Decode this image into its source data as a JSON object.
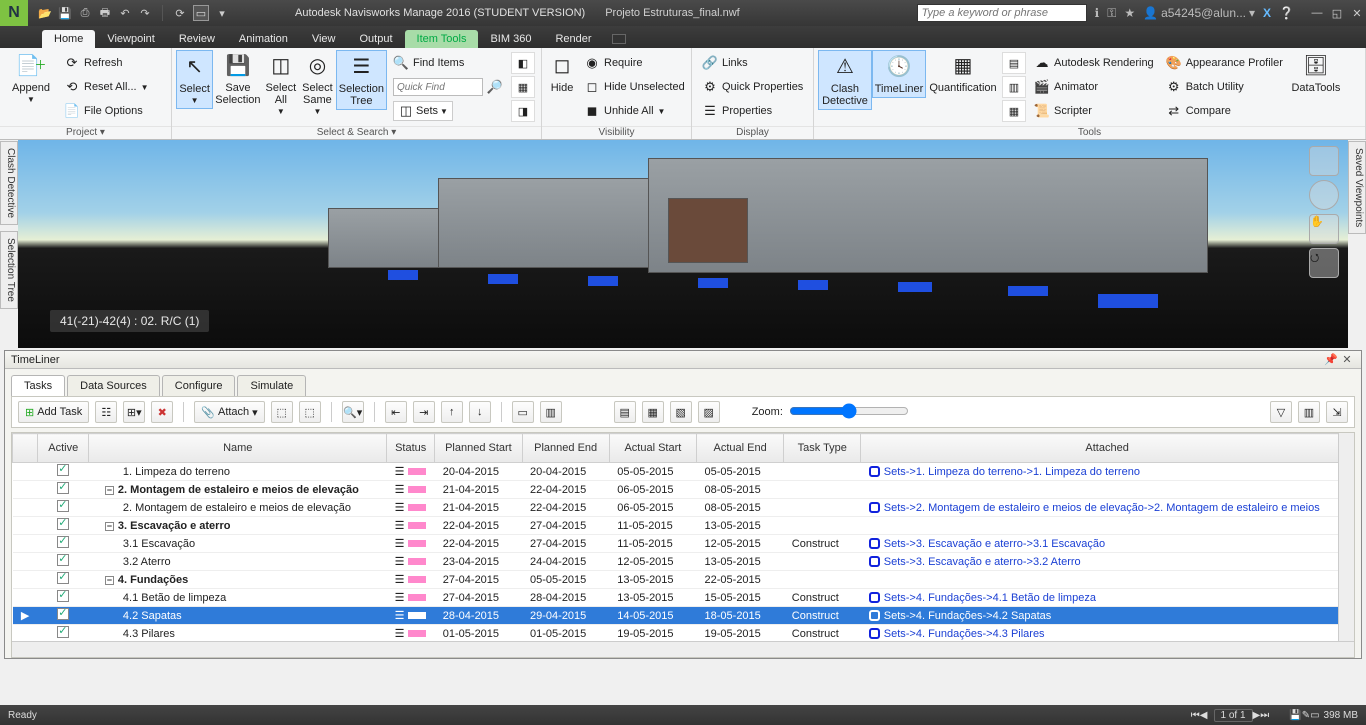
{
  "title": "Autodesk Navisworks Manage 2016 (STUDENT VERSION)",
  "filename": "Projeto Estruturas_final.nwf",
  "search_placeholder": "Type a keyword or phrase",
  "user": "a54245@alun...",
  "menu": [
    "Home",
    "Viewpoint",
    "Review",
    "Animation",
    "View",
    "Output",
    "Item Tools",
    "BIM 360",
    "Render"
  ],
  "menu_active": 0,
  "menu_ctx": 6,
  "ribbon": {
    "project": {
      "label": "Project ▾",
      "append": "Append",
      "items": [
        "Refresh",
        "Reset All...",
        "File Options"
      ]
    },
    "select": {
      "label": "Select & Search ▾",
      "select": "Select",
      "save_sel": "Save\nSelection",
      "sel_all": "Select\nAll",
      "sel_same": "Select\nSame",
      "sel_tree": "Selection\nTree",
      "find": "Find Items",
      "quick": "Quick Find",
      "sets": "Sets"
    },
    "visibility": {
      "label": "Visibility",
      "hide": "Hide",
      "rows": [
        "Require",
        "Hide Unselected",
        "Unhide All"
      ]
    },
    "display": {
      "label": "Display",
      "rows": [
        "Links",
        "Quick Properties",
        "Properties"
      ]
    },
    "clash": "Clash\nDetective",
    "timeliner": "TimeLiner",
    "quant": "Quantification",
    "tools": {
      "label": "Tools",
      "col1": [
        "Autodesk Rendering",
        "Animator",
        "Scripter"
      ],
      "col2": [
        "Appearance Profiler",
        "Batch Utility",
        "Compare"
      ]
    },
    "datatools": "DataTools"
  },
  "viewport_overlay": "41(-21)-42(4) : 02. R/C (1)",
  "side_left": [
    "Clash Detective",
    "Selection Tree"
  ],
  "side_right": [
    "Saved Viewpoints"
  ],
  "panel_title": "TimeLiner",
  "tl_tabs": [
    "Tasks",
    "Data Sources",
    "Configure",
    "Simulate"
  ],
  "tl_tab_active": 0,
  "add_task": "Add Task",
  "attach": "Attach",
  "zoom": "Zoom:",
  "columns": [
    "",
    "Active",
    "Name",
    "Status",
    "Planned Start",
    "Planned End",
    "Actual Start",
    "Actual End",
    "Task Type",
    "Attached"
  ],
  "rows": [
    {
      "mark": "",
      "lvl": 1,
      "exp": "",
      "name": "1. Limpeza do terreno",
      "ps": "20-04-2015",
      "pe": "20-04-2015",
      "as": "05-05-2015",
      "ae": "05-05-2015",
      "tt": "",
      "att": "Sets->1. Limpeza do terreno->1. Limpeza do terreno",
      "ico": 0
    },
    {
      "mark": "",
      "lvl": 0,
      "exp": "-",
      "name": "2. Montagem de estaleiro e meios de elevação",
      "bold": 1,
      "ps": "21-04-2015",
      "pe": "22-04-2015",
      "as": "06-05-2015",
      "ae": "08-05-2015",
      "tt": "",
      "att": ""
    },
    {
      "mark": "",
      "lvl": 1,
      "exp": "",
      "name": "2. Montagem de estaleiro e meios de elevação",
      "ps": "21-04-2015",
      "pe": "22-04-2015",
      "as": "06-05-2015",
      "ae": "08-05-2015",
      "tt": "",
      "att": "Sets->2. Montagem de estaleiro e meios de elevação->2. Montagem de estaleiro e meios",
      "ico": 1
    },
    {
      "mark": "",
      "lvl": 0,
      "exp": "-",
      "name": "3. Escavação e aterro",
      "bold": 1,
      "ps": "22-04-2015",
      "pe": "27-04-2015",
      "as": "11-05-2015",
      "ae": "13-05-2015",
      "tt": "",
      "att": ""
    },
    {
      "mark": "",
      "lvl": 1,
      "exp": "",
      "name": "3.1 Escavação",
      "ps": "22-04-2015",
      "pe": "27-04-2015",
      "as": "11-05-2015",
      "ae": "12-05-2015",
      "tt": "Construct",
      "att": "Sets->3. Escavação e aterro->3.1 Escavação",
      "ico": 1
    },
    {
      "mark": "",
      "lvl": 1,
      "exp": "",
      "name": "3.2 Aterro",
      "ps": "23-04-2015",
      "pe": "24-04-2015",
      "as": "12-05-2015",
      "ae": "13-05-2015",
      "tt": "",
      "att": "Sets->3. Escavação e aterro->3.2 Aterro",
      "ico": 1
    },
    {
      "mark": "",
      "lvl": 0,
      "exp": "-",
      "name": "4. Fundações",
      "bold": 1,
      "ps": "27-04-2015",
      "pe": "05-05-2015",
      "as": "13-05-2015",
      "ae": "22-05-2015",
      "tt": "",
      "att": ""
    },
    {
      "mark": "",
      "lvl": 1,
      "exp": "",
      "name": "4.1 Betão de limpeza",
      "ps": "27-04-2015",
      "pe": "28-04-2015",
      "as": "13-05-2015",
      "ae": "15-05-2015",
      "tt": "Construct",
      "att": "Sets->4. Fundações->4.1 Betão de limpeza",
      "ico": 1
    },
    {
      "mark": "▶",
      "lvl": 1,
      "exp": "",
      "name": "4.2 Sapatas",
      "ps": "28-04-2015",
      "pe": "29-04-2015",
      "as": "14-05-2015",
      "ae": "18-05-2015",
      "tt": "Construct",
      "att": "Sets->4. Fundações->4.2 Sapatas",
      "ico": 1,
      "sel": 1
    },
    {
      "mark": "",
      "lvl": 1,
      "exp": "",
      "name": "4.3 Pilares",
      "ps": "01-05-2015",
      "pe": "01-05-2015",
      "as": "19-05-2015",
      "ae": "19-05-2015",
      "tt": "Construct",
      "att": "Sets->4. Fundações->4.3 Pilares",
      "ico": 1
    }
  ],
  "status": {
    "ready": "Ready",
    "page": "1 of 1",
    "mem": "398 MB"
  }
}
